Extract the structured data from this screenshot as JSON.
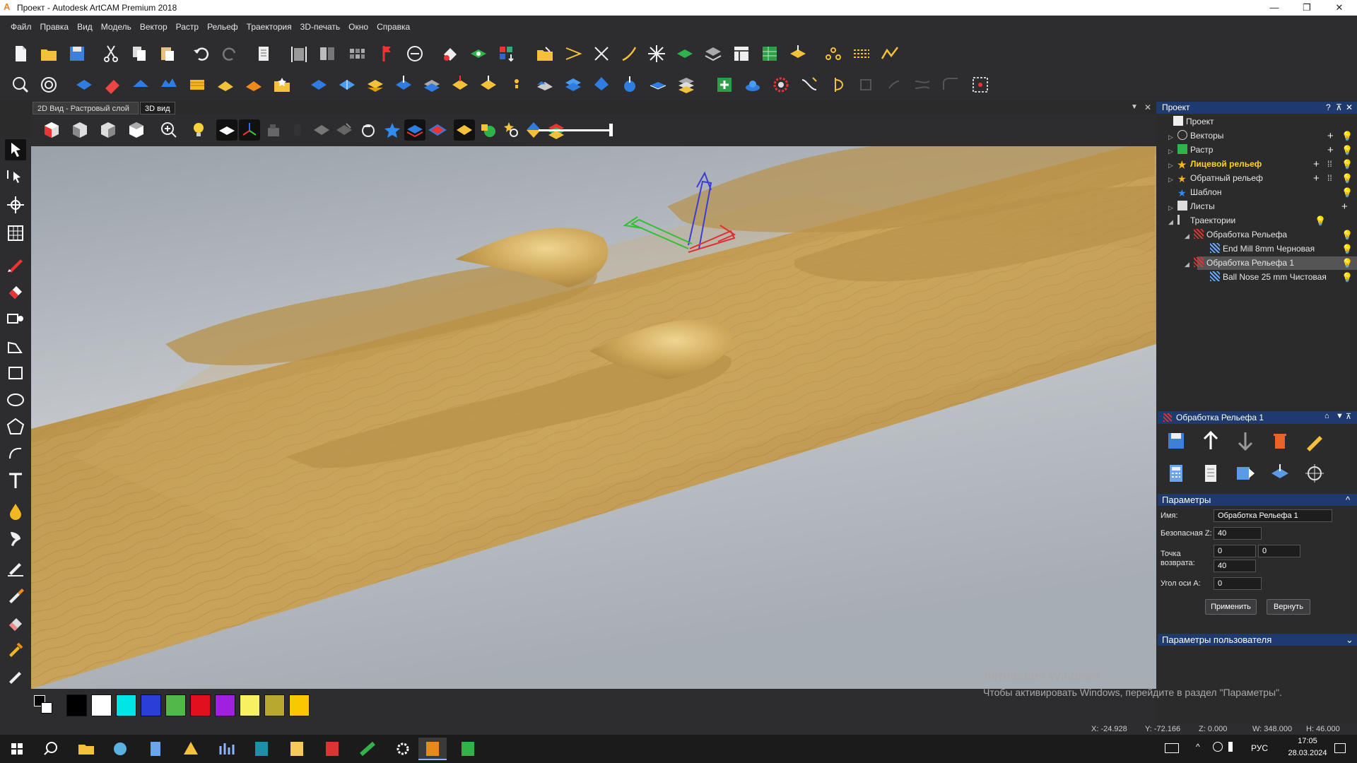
{
  "window": {
    "title": "Проект - Autodesk ArtCAM Premium 2018",
    "app_letter": "A",
    "minimize": "—",
    "maximize": "❐",
    "close": "✕"
  },
  "menu": [
    "Файл",
    "Правка",
    "Вид",
    "Модель",
    "Вектор",
    "Растр",
    "Рельеф",
    "Траектория",
    "3D-печать",
    "Окно",
    "Справка"
  ],
  "view_tabs": {
    "tab_2d": "2D Вид - Растровый слой",
    "tab_3d": "3D вид"
  },
  "viewport_controls": {
    "menu_arrow": "▼",
    "close": "✕"
  },
  "project_panel": {
    "header": "Проект",
    "header_buttons": [
      "?",
      "⊼",
      "✕"
    ],
    "tree": [
      {
        "label": "Проект",
        "bold": false
      },
      {
        "label": "Векторы",
        "bold": false
      },
      {
        "label": "Растр",
        "bold": false
      },
      {
        "label": "Лицевой рельеф",
        "bold": true,
        "color": "#ffd21f"
      },
      {
        "label": "Обратный рельеф",
        "bold": false
      },
      {
        "label": "Шаблон",
        "bold": false
      },
      {
        "label": "Листы",
        "bold": false
      },
      {
        "label": "Траектории",
        "bold": false
      },
      {
        "label": "Обработка Рельефа",
        "bold": false
      },
      {
        "label": "End Mill 8mm Черновая",
        "bold": false
      },
      {
        "label": "Обработка Рельефа 1",
        "bold": false,
        "selected": true
      },
      {
        "label": "Ball Nose 25 mm Чистовая",
        "bold": false
      }
    ]
  },
  "toolpath_panel": {
    "header": "Обработка Рельефа 1",
    "params_header": "Параметры",
    "name_label": "Имя:",
    "name_value": "Обработка Рельефа 1",
    "safe_z_label": "Безопасная Z:",
    "safe_z_value": "40",
    "home_label_1": "Точка",
    "home_label_2": "возврата:",
    "home_x": "0",
    "home_y": "0",
    "home_z": "40",
    "a_axis_label": "Угол оси A:",
    "a_axis_value": "0",
    "apply_button": "Применить",
    "revert_button": "Вернуть",
    "user_params_header": "Параметры пользователя",
    "collapse_up": "^",
    "collapse_down": "⌄"
  },
  "palette": {
    "colors": [
      "#000000",
      "#ffffff",
      "#00e6e6",
      "#2a3fd8",
      "#52b84a",
      "#e0101e",
      "#a020e0",
      "#f8f060",
      "#b8a830",
      "#f8c800"
    ]
  },
  "status": {
    "x": "X: -24.928",
    "y": "Y: -72.166",
    "z": "Z: 0.000",
    "w": "W: 348.000",
    "h": "H: 46.000"
  },
  "watermark": {
    "line1": "Активация Windows",
    "line2": "Чтобы активировать Windows, перейдите в раздел \"Параметры\"."
  },
  "taskbar": {
    "lang": "РУС",
    "time": "17:05",
    "date": "28.03.2024"
  },
  "colors": {
    "accent": "#1e3a6e",
    "wood": "#c9a35a",
    "background": "#2b2b2b"
  }
}
